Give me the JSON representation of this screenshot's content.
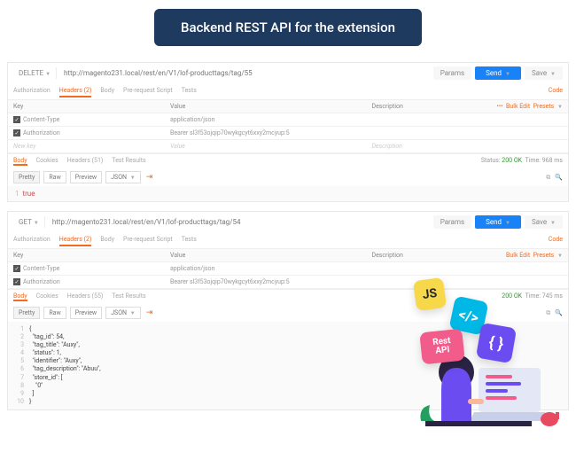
{
  "banner": "Backend REST API for the extension",
  "method": {
    "delete": "DELETE",
    "get": "GET"
  },
  "url": {
    "top": "http://magento231.local/rest/en/V1/lof-producttags/tag/55",
    "bot": "http://magento231.local/rest/en/V1/lof-producttags/tag/54"
  },
  "btns": {
    "params": "Params",
    "send": "Send",
    "save": "Save"
  },
  "reqtabs": {
    "auth": "Authorization",
    "headers": "Headers (2)",
    "body": "Body",
    "pre": "Pre-request Script",
    "tests": "Tests",
    "code": "Code"
  },
  "cols": {
    "key": "Key",
    "value": "Value",
    "desc": "Description",
    "bulk": "Bulk Edit",
    "presets": "Presets",
    "dots": "•••"
  },
  "hdr": {
    "ct_k": "Content-Type",
    "ct_v": "application/json",
    "au_k": "Authorization",
    "au_v1": "Bearer sl3f53ojqip70wykgcyt6xxy2mcyup:5",
    "au_v2": "Bearer sl3f53ojqip70wykgcyt6xxy2mcyup:5",
    "new": "New key",
    "newv": "Value",
    "newd": "Description"
  },
  "restabs": {
    "body": "Body",
    "cookies": "Cookies",
    "headers1": "Headers (51)",
    "headers2": "Headers (55)",
    "tr": "Test Results"
  },
  "status": {
    "s": "Status:",
    "ok": "200 OK",
    "t": "Time:",
    "t1": "968 ms",
    "t2": "745 ms"
  },
  "pretty": {
    "pretty": "Pretty",
    "raw": "Raw",
    "preview": "Preview",
    "json": "JSON"
  },
  "b1": "true",
  "json": {
    "l1": "\"tag_id\": 54,",
    "l2": "\"tag_title\": \"Auxy\",",
    "l3": "\"status\": 1,",
    "l4": "\"identifier\": \"Auxy\",",
    "l5": "\"tag_description\": \"Abuu\",",
    "l6": "\"store_id\": [",
    "l7": "\"0\"",
    "l8": "]",
    "l9": "}"
  },
  "badges": {
    "js": "JS",
    "code": "</>",
    "rest": "Rest\nAPI",
    "brace": "{ }"
  }
}
